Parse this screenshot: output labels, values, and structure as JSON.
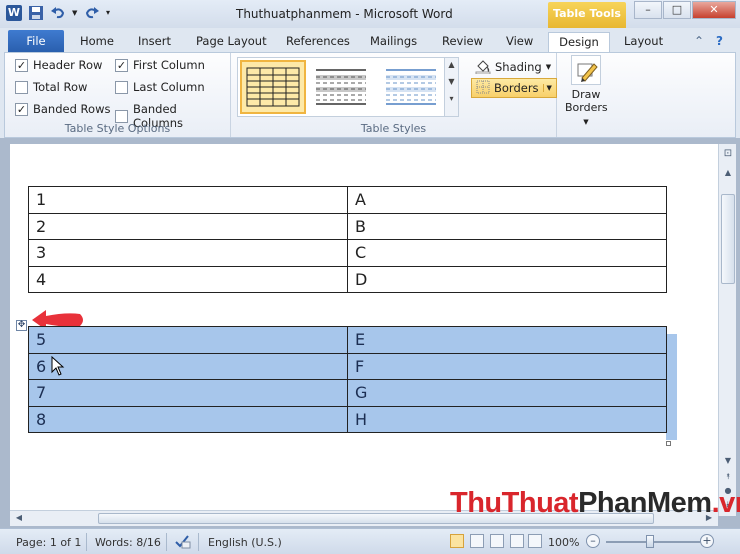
{
  "window": {
    "title": "Thuthuatphanmem - Microsoft Word",
    "context_tab": "Table Tools"
  },
  "ribbon_tabs": [
    "File",
    "Home",
    "Insert",
    "Page Layout",
    "References",
    "Mailings",
    "Review",
    "View",
    "Design",
    "Layout"
  ],
  "active_tab": "Design",
  "table_style_options": {
    "label": "Table Style Options",
    "items": [
      {
        "label": "Header Row",
        "checked": true
      },
      {
        "label": "Total Row",
        "checked": false
      },
      {
        "label": "Banded Rows",
        "checked": true
      },
      {
        "label": "First Column",
        "checked": true
      },
      {
        "label": "Last Column",
        "checked": false
      },
      {
        "label": "Banded Columns",
        "checked": false
      }
    ]
  },
  "table_styles": {
    "label": "Table Styles",
    "shading_label": "Shading",
    "borders_label": "Borders"
  },
  "draw_borders": {
    "label_line1": "Draw",
    "label_line2": "Borders"
  },
  "document": {
    "table1": [
      [
        "1",
        "A"
      ],
      [
        "2",
        "B"
      ],
      [
        "3",
        "C"
      ],
      [
        "4",
        "D"
      ]
    ],
    "table2": [
      [
        "5",
        "E"
      ],
      [
        "6",
        "F"
      ],
      [
        "7",
        "G"
      ],
      [
        "8",
        "H"
      ]
    ]
  },
  "statusbar": {
    "page": "Page: 1 of 1",
    "words": "Words: 8/16",
    "language": "English (U.S.)",
    "zoom": "100%"
  },
  "watermark": {
    "part1": "ThuThuat",
    "part2": "PhanMem",
    "part3": ".vn"
  },
  "colors": {
    "selection": "#a7c6eb",
    "file_tab": "#2a5fae",
    "context": "#e8b732",
    "arrow": "#e8313a"
  }
}
